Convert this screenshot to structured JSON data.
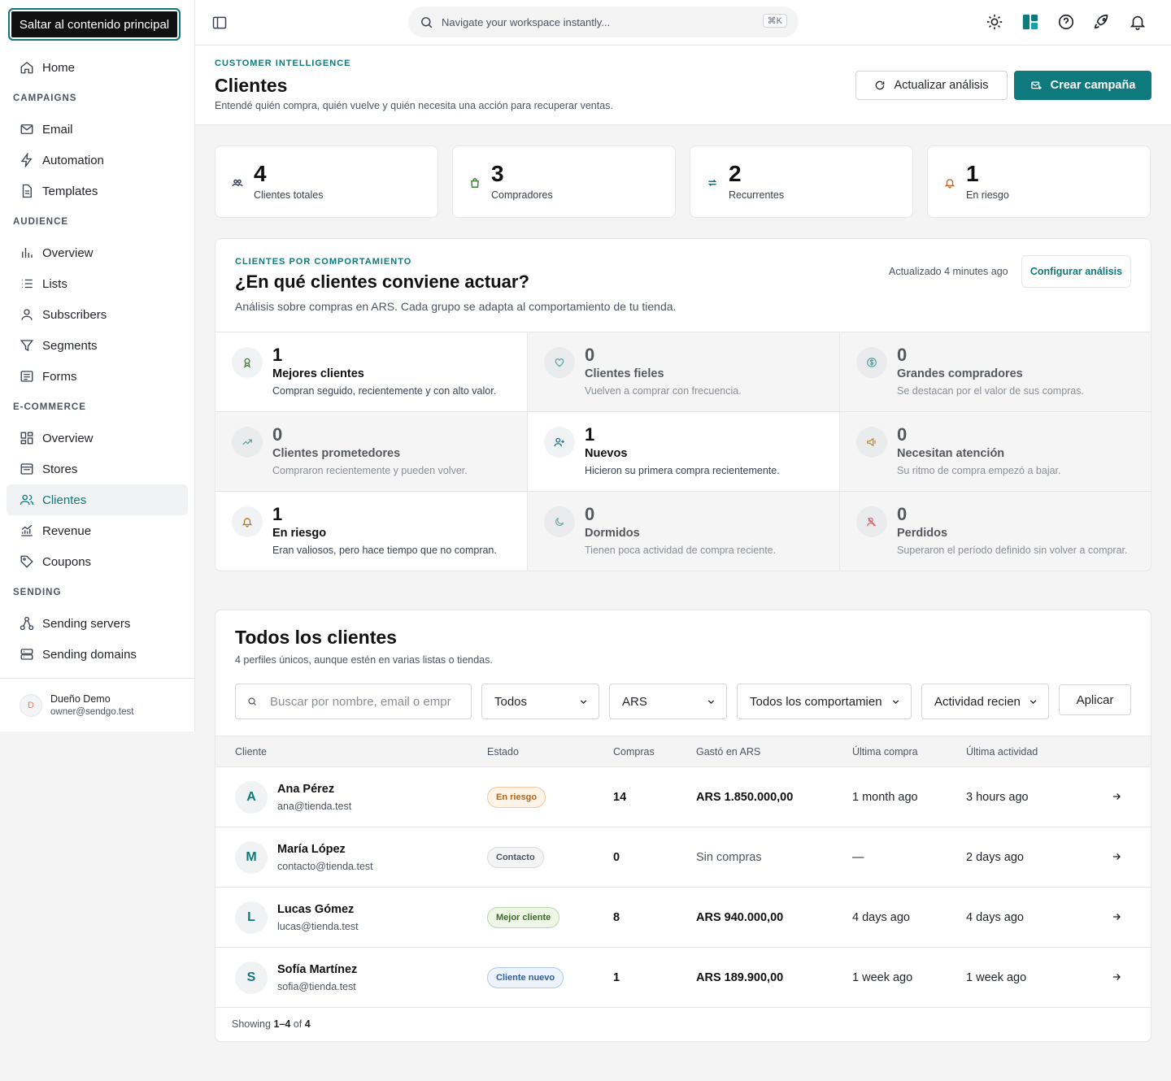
{
  "skip_link": "Saltar al contenido principal",
  "nav": {
    "home": "Home",
    "campaigns_section": "CAMPAIGNS",
    "email": "Email",
    "automation": "Automation",
    "templates": "Templates",
    "audience_section": "AUDIENCE",
    "overview": "Overview",
    "lists": "Lists",
    "subscribers": "Subscribers",
    "segments": "Segments",
    "forms": "Forms",
    "ecommerce_section": "E-COMMERCE",
    "ec_overview": "Overview",
    "stores": "Stores",
    "clientes": "Clientes",
    "revenue": "Revenue",
    "coupons": "Coupons",
    "sending_section": "SENDING",
    "sending_servers": "Sending servers",
    "sending_domains": "Sending domains"
  },
  "user": {
    "initial": "D",
    "name": "Dueño Demo",
    "email": "owner@sendgo.test"
  },
  "topbar": {
    "search_placeholder": "Navigate your workspace instantly...",
    "shortcut": "⌘K"
  },
  "header": {
    "eyebrow": "CUSTOMER INTELLIGENCE",
    "title": "Clientes",
    "subtitle": "Entendé quién compra, quién vuelve y quién necesita una acción para recuperar ventas.",
    "refresh_label": "Actualizar análisis",
    "create_label": "Crear campaña"
  },
  "stats": [
    {
      "value": "4",
      "label": "Clientes totales",
      "icon": "users-icon"
    },
    {
      "value": "3",
      "label": "Compradores",
      "icon": "bag-icon"
    },
    {
      "value": "2",
      "label": "Recurrentes",
      "icon": "repeat-icon"
    },
    {
      "value": "1",
      "label": "En riesgo",
      "icon": "bell-alert-icon"
    }
  ],
  "behavior": {
    "eyebrow": "CLIENTES POR COMPORTAMIENTO",
    "title": "¿En qué clientes conviene actuar?",
    "subtitle": "Análisis sobre compras en ARS. Cada grupo se adapta al comportamiento de tu tienda.",
    "updated": "Actualizado 4 minutes ago",
    "config_label": "Configurar análisis",
    "segments": [
      {
        "count": "1",
        "name": "Mejores clientes",
        "desc": "Compran seguido, recientemente y con alto valor.",
        "icon": "award-icon",
        "icon_color": "#3f7a3a"
      },
      {
        "count": "0",
        "name": "Clientes fieles",
        "desc": "Vuelven a comprar con frecuencia.",
        "icon": "heart-icon",
        "icon_color": "#5aa3a6"
      },
      {
        "count": "0",
        "name": "Grandes compradores",
        "desc": "Se destacan por el valor de sus compras.",
        "icon": "dollar-icon",
        "icon_color": "#5aa3a6"
      },
      {
        "count": "0",
        "name": "Clientes prometedores",
        "desc": "Compraron recientemente y pueden volver.",
        "icon": "trend-icon",
        "icon_color": "#5aa3a6"
      },
      {
        "count": "1",
        "name": "Nuevos",
        "desc": "Hicieron su primera compra recientemente.",
        "icon": "user-plus-icon",
        "icon_color": "#1f6f8b"
      },
      {
        "count": "0",
        "name": "Necesitan atención",
        "desc": "Su ritmo de compra empezó a bajar.",
        "icon": "megaphone-icon",
        "icon_color": "#c08a3a"
      },
      {
        "count": "1",
        "name": "En riesgo",
        "desc": "Eran valiosos, pero hace tiempo que no compran.",
        "icon": "bell-icon",
        "icon_color": "#b07a1a"
      },
      {
        "count": "0",
        "name": "Dormidos",
        "desc": "Tienen poca actividad de compra reciente.",
        "icon": "moon-icon",
        "icon_color": "#7aa8ad"
      },
      {
        "count": "0",
        "name": "Perdidos",
        "desc": "Superaron el período definido sin volver a comprar.",
        "icon": "user-x-icon",
        "icon_color": "#d26a6a"
      }
    ]
  },
  "clients": {
    "title": "Todos los clientes",
    "subtitle": "4 perfiles únicos, aunque estén en varias listas o tiendas.",
    "search_placeholder": "Buscar por nombre, email o empr",
    "filter_status": "Todos",
    "filter_currency": "ARS",
    "filter_behavior": "Todos los comportamien",
    "filter_activity": "Actividad recien",
    "apply_label": "Aplicar",
    "columns": [
      "Cliente",
      "Estado",
      "Compras",
      "Gastó en ARS",
      "Última compra",
      "Última actividad"
    ],
    "rows": [
      {
        "initial": "A",
        "name": "Ana Pérez",
        "email": "ana@tienda.test",
        "status": "En riesgo",
        "status_color": "#b5651d",
        "status_bg": "#fdf3e7",
        "purchases": "14",
        "spent": "ARS 1.850.000,00",
        "last_purchase": "1 month ago",
        "last_activity": "3 hours ago"
      },
      {
        "initial": "M",
        "name": "María López",
        "email": "contacto@tienda.test",
        "status": "Contacto",
        "status_color": "#4b5563",
        "status_bg": "#f4f4f5",
        "purchases": "0",
        "spent": "Sin compras",
        "last_purchase": "—",
        "last_activity": "2 days ago"
      },
      {
        "initial": "L",
        "name": "Lucas Gómez",
        "email": "lucas@tienda.test",
        "status": "Mejor cliente",
        "status_color": "#3f6b2a",
        "status_bg": "#eef6e8",
        "purchases": "8",
        "spent": "ARS 940.000,00",
        "last_purchase": "4 days ago",
        "last_activity": "4 days ago"
      },
      {
        "initial": "S",
        "name": "Sofía Martínez",
        "email": "sofia@tienda.test",
        "status": "Cliente nuevo",
        "status_color": "#2d5f9a",
        "status_bg": "#edf3fb",
        "purchases": "1",
        "spent": "ARS 189.900,00",
        "last_purchase": "1 week ago",
        "last_activity": "1 week ago"
      }
    ],
    "footer_prefix": "Showing",
    "footer_range": "1–4",
    "footer_of": "of",
    "footer_total": "4"
  }
}
